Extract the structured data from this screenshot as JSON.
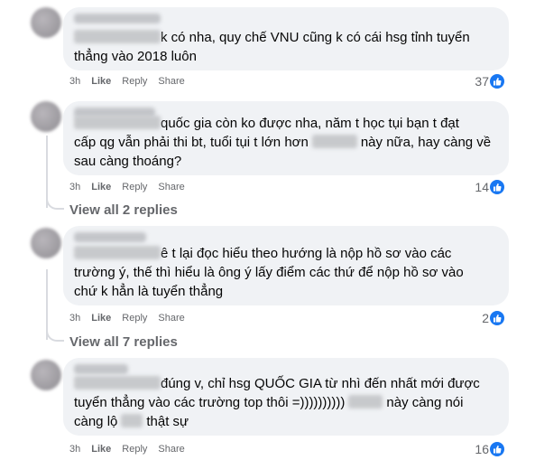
{
  "actions": {
    "time": "3h",
    "like": "Like",
    "reply": "Reply",
    "share": "Share"
  },
  "comments": [
    {
      "line1": "k có nha, quy chế VNU cũng k có cái hsg tỉnh tuyển",
      "line2": "thẳng vào 2018 luôn",
      "reactions": "37"
    },
    {
      "line1": "quốc gia còn ko được nha, năm t học tụi bạn t đạt",
      "line2a": "cấp qg vẫn phải thi bt, tuổi tụi t lớn hơn",
      "line2b": "này nữa, hay càng về",
      "line3": "sau càng thoáng?",
      "reactions": "14",
      "view_replies": "View all 2 replies"
    },
    {
      "line1": "ê t lại đọc hiểu theo hướng là nộp hồ sơ vào các",
      "line2": "trường ý, thế thì hiểu là ông ý lấy điểm các thứ để nộp hồ sơ vào",
      "line3": "chứ k hẳn là tuyển thẳng",
      "reactions": "2",
      "view_replies": "View all 7 replies"
    },
    {
      "line1": "đúng v, chỉ hsg QUỐC GIA từ nhì đến nhất mới được",
      "line2a": "tuyển thẳng vào các trường top thôi =))))))))))",
      "line2b": "này càng nói",
      "line3a": "càng lộ",
      "line3b": "thật sự",
      "reactions": "16"
    }
  ],
  "colors": {
    "like_blue": "#1877f2",
    "bubble": "#f0f2f5",
    "meta_gray": "#65676b"
  }
}
